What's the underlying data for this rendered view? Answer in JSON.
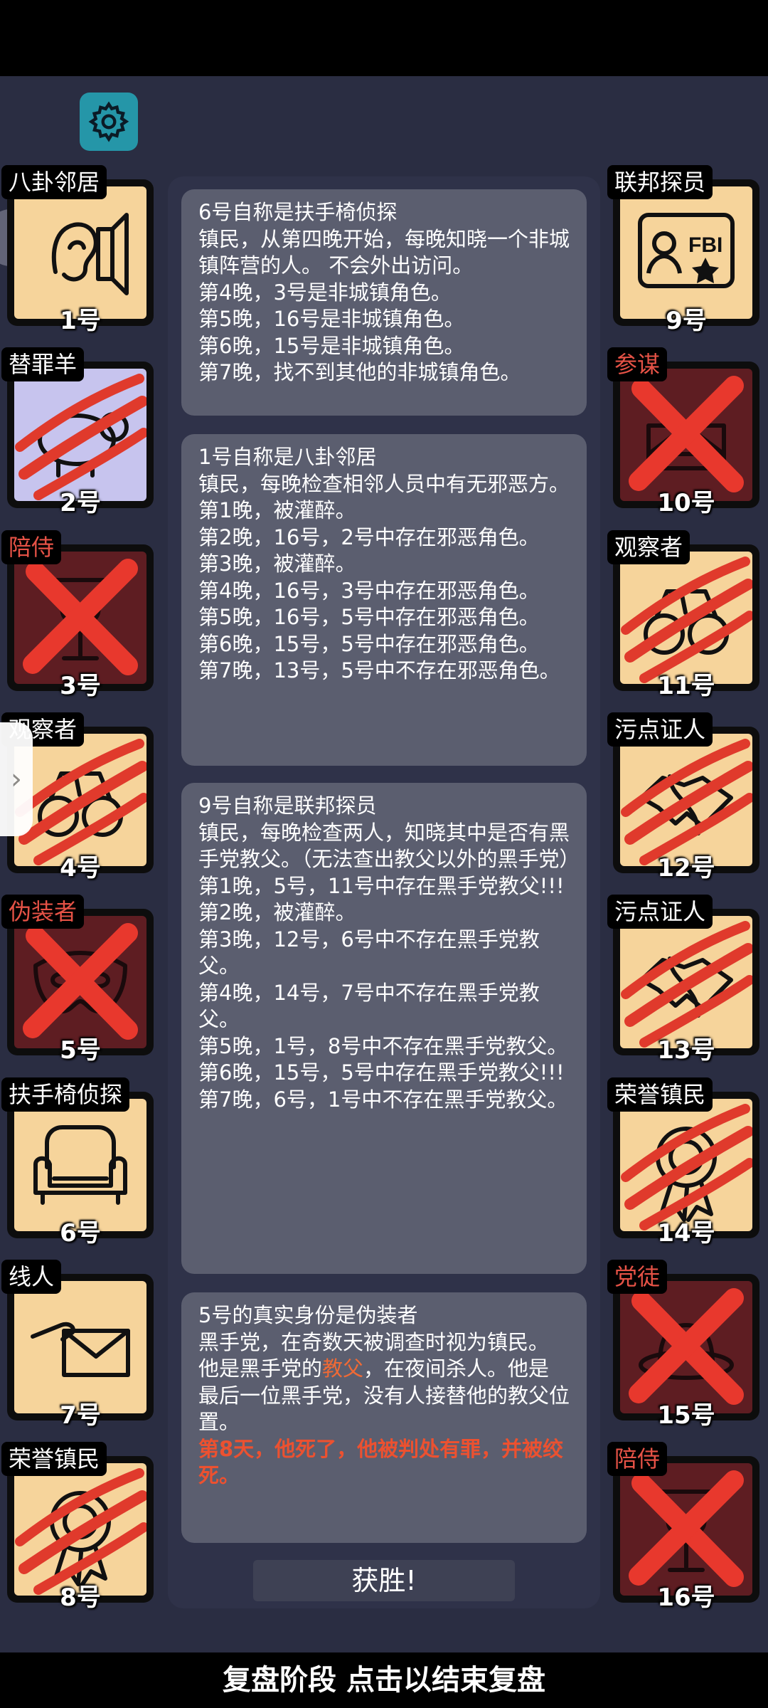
{
  "settings": {
    "icon": "gear-icon"
  },
  "players_left": [
    {
      "role": "八卦邻居",
      "number": "1号",
      "role_color": "white",
      "state": "alive",
      "icon": "ear-speaker-icon"
    },
    {
      "role": "替罪羊",
      "number": "2号",
      "role_color": "white",
      "state": "dead",
      "icon": "sheep-icon"
    },
    {
      "role": "陪侍",
      "number": "3号",
      "role_color": "red",
      "state": "executed",
      "icon": "goblet-icon"
    },
    {
      "role": "观察者",
      "number": "4号",
      "role_color": "white",
      "state": "dead",
      "icon": "binoculars-icon"
    },
    {
      "role": "伪装者",
      "number": "5号",
      "role_color": "red",
      "state": "executed",
      "icon": "mask-icon"
    },
    {
      "role": "扶手椅侦探",
      "number": "6号",
      "role_color": "white",
      "state": "alive",
      "icon": "armchair-icon"
    },
    {
      "role": "线人",
      "number": "7号",
      "role_color": "white",
      "state": "alive",
      "icon": "envelope-hand-icon"
    },
    {
      "role": "荣誉镇民",
      "number": "8号",
      "role_color": "white",
      "state": "dead",
      "icon": "medal-icon"
    }
  ],
  "players_right": [
    {
      "role": "联邦探员",
      "number": "9号",
      "role_color": "white",
      "state": "alive",
      "icon": "fbi-badge-icon"
    },
    {
      "role": "参谋",
      "number": "10号",
      "role_color": "red",
      "state": "executed",
      "icon": "envelope-icon"
    },
    {
      "role": "观察者",
      "number": "11号",
      "role_color": "white",
      "state": "dead",
      "icon": "binoculars-icon"
    },
    {
      "role": "污点证人",
      "number": "12号",
      "role_color": "white",
      "state": "dead",
      "icon": "handshake-icon"
    },
    {
      "role": "污点证人",
      "number": "13号",
      "role_color": "white",
      "state": "dead",
      "icon": "handshake-icon"
    },
    {
      "role": "荣誉镇民",
      "number": "14号",
      "role_color": "white",
      "state": "dead",
      "icon": "medal-icon"
    },
    {
      "role": "党徒",
      "number": "15号",
      "role_color": "red",
      "state": "executed",
      "icon": "hat-icon"
    },
    {
      "role": "陪侍",
      "number": "16号",
      "role_color": "red",
      "state": "executed",
      "icon": "goblet-icon"
    }
  ],
  "messages": [
    {
      "lines": [
        "6号自称是扶手椅侦探",
        "镇民，从第四晚开始，每晚知晓一个非城镇阵营的人。 不会外出访问。",
        "第4晚，3号是非城镇角色。",
        "第5晚，16号是非城镇角色。",
        "第6晚，15号是非城镇角色。",
        "第7晚，找不到其他的非城镇角色。"
      ]
    },
    {
      "lines": [
        "1号自称是八卦邻居",
        "镇民，每晚检查相邻人员中有无邪恶方。",
        "第1晚，被灌醉。",
        "第2晚，16号，2号中存在邪恶角色。",
        "第3晚，被灌醉。",
        "第4晚，16号，3号中存在邪恶角色。",
        "第5晚，16号，5号中存在邪恶角色。",
        "第6晚，15号，5号中存在邪恶角色。",
        "第7晚，13号，5号中不存在邪恶角色。"
      ]
    },
    {
      "lines": [
        "9号自称是联邦探员",
        "镇民，每晚检查两人，知晓其中是否有黑手党教父。（无法查出教父以外的黑手党）",
        "第1晚，5号，11号中存在黑手党教父!!!",
        "第2晚，被灌醉。",
        "第3晚，12号，6号中不存在黑手党教父。",
        "第4晚，14号，7号中不存在黑手党教父。",
        "第5晚，1号，8号中不存在黑手党教父。",
        "第6晚，15号，5号中存在黑手党教父!!!",
        "第7晚，6号，1号中不存在黑手党教父。"
      ]
    },
    {
      "line1": "5号的真实身份是伪装者",
      "line2": "黑手党，在奇数天被调查时视为镇民。",
      "line3_a": "他是黑手党的",
      "line3_hl": "教父",
      "line3_b": "，在夜间杀人。他是最后一位黑手党，没有人接替他的教父位置。",
      "death": "第8天，他死了，他被判处有罪，并被绞死。"
    }
  ],
  "victory_label": "获胜!",
  "footer_label": "复盘阶段 点击以结束复盘",
  "colors": {
    "town_card": "#f6d49b",
    "evil_card": "#5e1d22",
    "red_text": "#e55246",
    "panel": "#5b5e6f",
    "background": "#2a2d42"
  }
}
